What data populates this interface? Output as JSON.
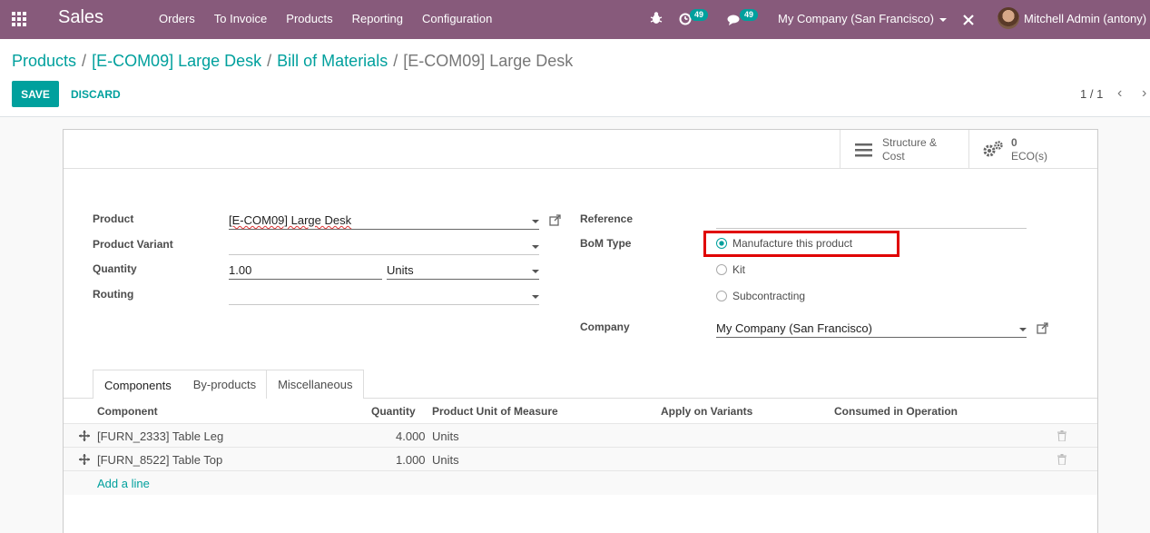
{
  "app": {
    "name": "Sales"
  },
  "menu": [
    "Orders",
    "To Invoice",
    "Products",
    "Reporting",
    "Configuration"
  ],
  "systray": {
    "activity_count": "49",
    "message_count": "49",
    "company": "My Company (San Francisco)",
    "user": "Mitchell Admin (antony)"
  },
  "breadcrumb": {
    "items": [
      "Products",
      "[E-COM09] Large Desk",
      "Bill of Materials"
    ],
    "current": "[E-COM09] Large Desk",
    "separator": "/"
  },
  "buttons": {
    "save": "SAVE",
    "discard": "DISCARD"
  },
  "pager": {
    "value": "1 / 1"
  },
  "stat_buttons": {
    "structure_line1": "Structure &",
    "structure_line2": "Cost",
    "eco_count": "0",
    "eco_label": "ECO(s)"
  },
  "form": {
    "product_label": "Product",
    "product_value": "[E-COM09] Large Desk",
    "variant_label": "Product Variant",
    "variant_value": "",
    "quantity_label": "Quantity",
    "quantity_value": "1.00",
    "uom_value": "Units",
    "routing_label": "Routing",
    "routing_value": "",
    "reference_label": "Reference",
    "reference_value": "",
    "bom_type_label": "BoM Type",
    "bom_types": [
      "Manufacture this product",
      "Kit",
      "Subcontracting"
    ],
    "bom_type_selected": "Manufacture this product",
    "company_label": "Company",
    "company_value": "My Company (San Francisco)"
  },
  "tabs": [
    "Components",
    "By-products",
    "Miscellaneous"
  ],
  "table": {
    "headers": [
      "Component",
      "Quantity",
      "Product Unit of Measure",
      "Apply on Variants",
      "Consumed in Operation"
    ],
    "rows": [
      {
        "component": "[FURN_2333] Table Leg",
        "quantity": "4.000",
        "uom": "Units"
      },
      {
        "component": "[FURN_8522] Table Top",
        "quantity": "1.000",
        "uom": "Units"
      }
    ],
    "add_line": "Add a line"
  },
  "colors": {
    "navbar": "#875a7b",
    "accent": "#00a09d",
    "highlight": "#e00000"
  }
}
